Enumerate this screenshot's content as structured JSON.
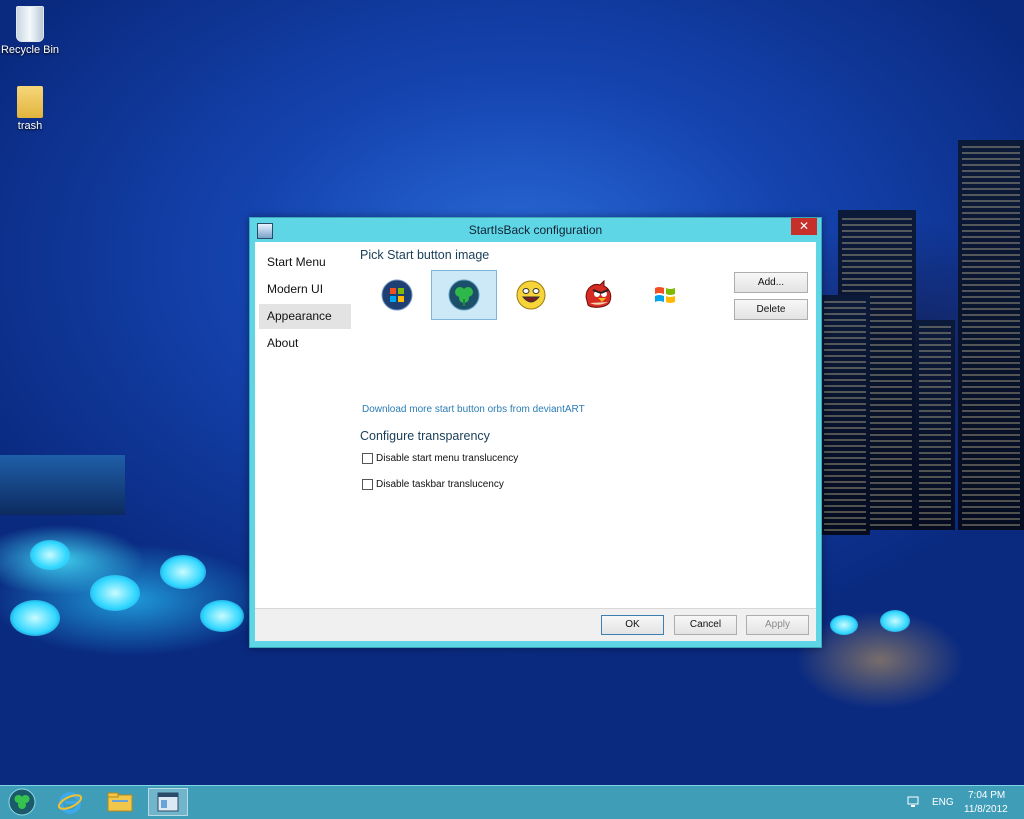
{
  "desktop": {
    "icons": [
      {
        "label": "Recycle Bin",
        "icon": "recycle-bin-icon"
      },
      {
        "label": "trash",
        "icon": "folder-icon"
      }
    ]
  },
  "window": {
    "title": "StartIsBack configuration",
    "close_glyph": "✕",
    "sidebar": {
      "items": [
        {
          "label": "Start Menu"
        },
        {
          "label": "Modern UI"
        },
        {
          "label": "Appearance",
          "active": true
        },
        {
          "label": "About"
        }
      ]
    },
    "start_button": {
      "heading": "Pick Start button image",
      "orbs": [
        {
          "icon": "windows7-orb-icon",
          "selected": false
        },
        {
          "icon": "shamrock-orb-icon",
          "selected": true
        },
        {
          "icon": "smiley-face-icon",
          "selected": false
        },
        {
          "icon": "angry-bird-icon",
          "selected": false
        },
        {
          "icon": "windows-flag-icon",
          "selected": false
        }
      ],
      "add_label": "Add...",
      "delete_label": "Delete",
      "download_link": "Download more start button orbs from deviantART"
    },
    "transparency": {
      "heading": "Configure transparency",
      "options": [
        {
          "label": "Disable start menu translucency",
          "checked": false
        },
        {
          "label": "Disable taskbar translucency",
          "checked": false
        }
      ]
    },
    "footer": {
      "ok_label": "OK",
      "cancel_label": "Cancel",
      "apply_label": "Apply"
    }
  },
  "taskbar": {
    "items": [
      {
        "icon": "start-orb-icon"
      },
      {
        "icon": "internet-explorer-icon"
      },
      {
        "icon": "file-explorer-icon"
      },
      {
        "icon": "startisback-config-icon",
        "active": true
      }
    ],
    "tray": {
      "language": "ENG",
      "time": "7:04 PM",
      "date": "11/8/2012"
    }
  },
  "colors": {
    "window_frame": "#5fd6e6",
    "close_button": "#c7302a",
    "link": "#2a7cb5",
    "taskbar": "#46aabe"
  }
}
